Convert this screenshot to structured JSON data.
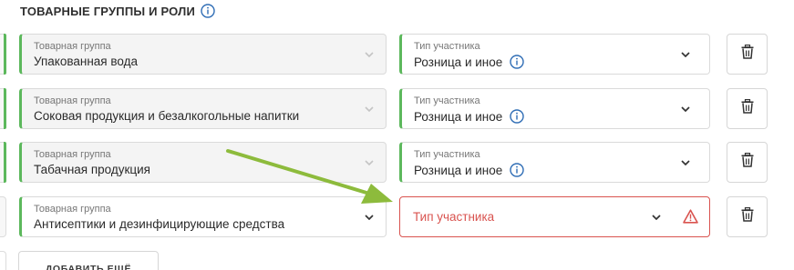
{
  "section": {
    "title": "ТОВАРНЫЕ ГРУППЫ И РОЛИ"
  },
  "rows": [
    {
      "group_label": "Товарная группа",
      "group_value": "Упакованная вода",
      "type_label": "Тип участника",
      "type_value": "Розница и иное"
    },
    {
      "group_label": "Товарная группа",
      "group_value": "Соковая продукция и безалкогольные напитки",
      "type_label": "Тип участника",
      "type_value": "Розница и иное"
    },
    {
      "group_label": "Товарная группа",
      "group_value": "Табачная продукция",
      "type_label": "Тип участника",
      "type_value": "Розница и иное"
    },
    {
      "group_label": "Товарная группа",
      "group_value": "Антисептики и дезинфицирующие средства",
      "type_placeholder": "Тип участника"
    }
  ],
  "add_button": {
    "label": "ДОБАВИТЬ ЕЩЁ"
  },
  "colors": {
    "accent_green": "#5cb85c",
    "error_red": "#d9534f",
    "info_blue": "#2f6db5",
    "arrow_green": "#8dbb3c"
  },
  "icons": {
    "info": "info-icon",
    "chevron": "chevron-down-icon",
    "trash": "trash-icon",
    "warning": "warning-icon",
    "arrow": "annotation-arrow"
  }
}
